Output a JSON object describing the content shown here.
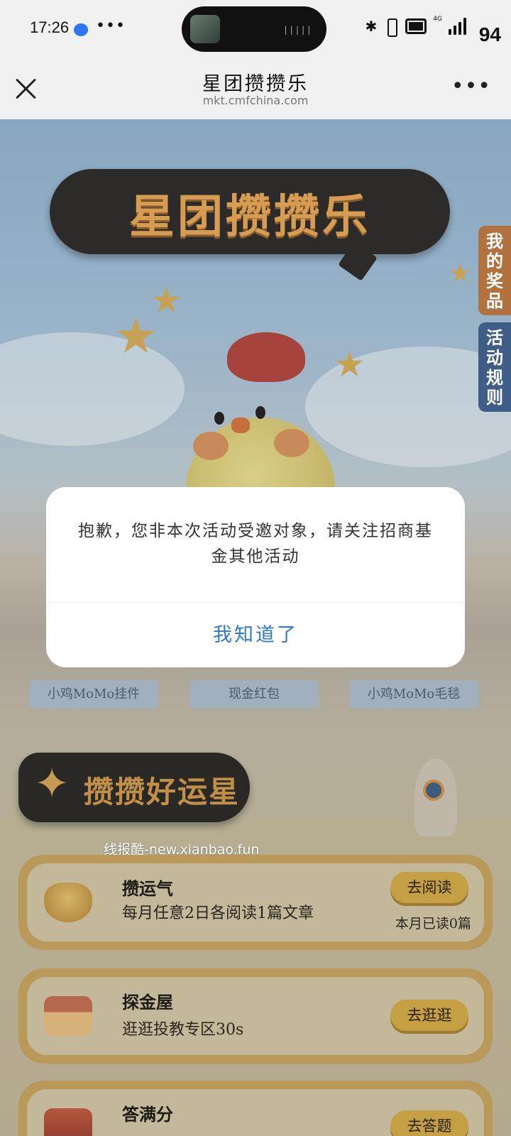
{
  "status_bar": {
    "time": "17:26",
    "more": "•••",
    "network_type": "4G",
    "battery_level": "94"
  },
  "title_bar": {
    "title": "星团攒攒乐",
    "url": "mkt.cmfchina.com"
  },
  "banner": {
    "title": "星团攒攒乐"
  },
  "side_tabs": {
    "my_prizes": "我的奖品",
    "rules": "活动规则"
  },
  "prizes": [
    {
      "label": "小鸡MoMo挂件"
    },
    {
      "label": "现金红包"
    },
    {
      "label": "小鸡MoMo毛毯"
    }
  ],
  "section": {
    "title": "攒攒好运星"
  },
  "watermark": "线报酷-new.xianbao.fun",
  "tasks": [
    {
      "title": "攒运气",
      "desc": "每月任意2日各阅读1篇文章",
      "button": "去阅读",
      "note": "本月已读0篇",
      "icon": "gold-ingot-icon"
    },
    {
      "title": "探金屋",
      "desc": "逛逛投教专区30s",
      "button": "去逛逛",
      "icon": "house-icon"
    },
    {
      "title": "答满分",
      "desc": "",
      "button": "去答题",
      "icon": "quiz-icon"
    }
  ],
  "modal": {
    "message": "抱歉，您非本次活动受邀对象，请关注招商基金其他活动",
    "button": "我知道了"
  },
  "colors": {
    "link_blue": "#2c7ad2",
    "tab_orange": "#b1723f",
    "tab_blue": "#3f5e87"
  }
}
